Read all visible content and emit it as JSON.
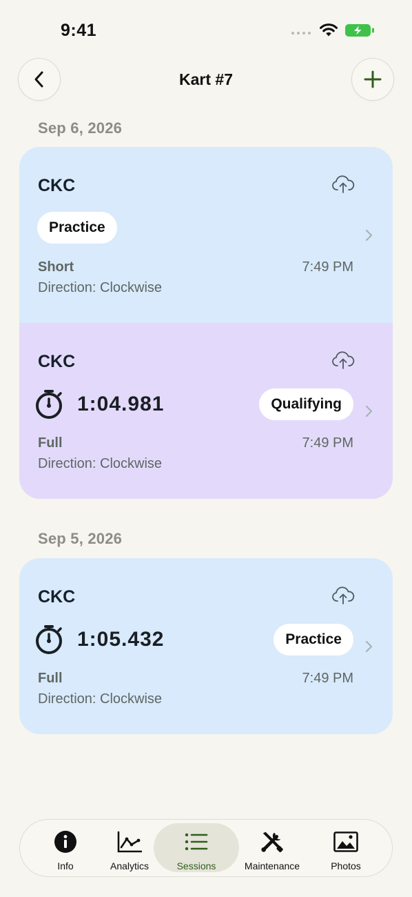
{
  "status_bar": {
    "time": "9:41"
  },
  "nav": {
    "title": "Kart #7"
  },
  "groups": [
    {
      "date": "Sep 6, 2026",
      "sessions": [
        {
          "track": "CKC",
          "type": "Practice",
          "layout": "Short",
          "direction": "Direction: Clockwise",
          "time": "7:49 PM",
          "color": "#d8eafb"
        },
        {
          "track": "CKC",
          "lap_time": "1:04.981",
          "type": "Qualifying",
          "layout": "Full",
          "direction": "Direction: Clockwise",
          "time": "7:49 PM",
          "color": "#e3dafb"
        }
      ]
    },
    {
      "date": "Sep 5, 2026",
      "sessions": [
        {
          "track": "CKC",
          "lap_time": "1:05.432",
          "type": "Practice",
          "layout": "Full",
          "direction": "Direction: Clockwise",
          "time": "7:49 PM",
          "color": "#d8eafb"
        }
      ]
    }
  ],
  "tabs": [
    {
      "label": "Info",
      "icon": "info-icon"
    },
    {
      "label": "Analytics",
      "icon": "analytics-icon"
    },
    {
      "label": "Sessions",
      "icon": "list-icon",
      "active": true
    },
    {
      "label": "Maintenance",
      "icon": "tools-icon"
    },
    {
      "label": "Photos",
      "icon": "photo-icon"
    }
  ],
  "colors": {
    "background": "#f6f5ef",
    "active_tab": "#2f5e1b",
    "battery": "#3ec24a"
  }
}
